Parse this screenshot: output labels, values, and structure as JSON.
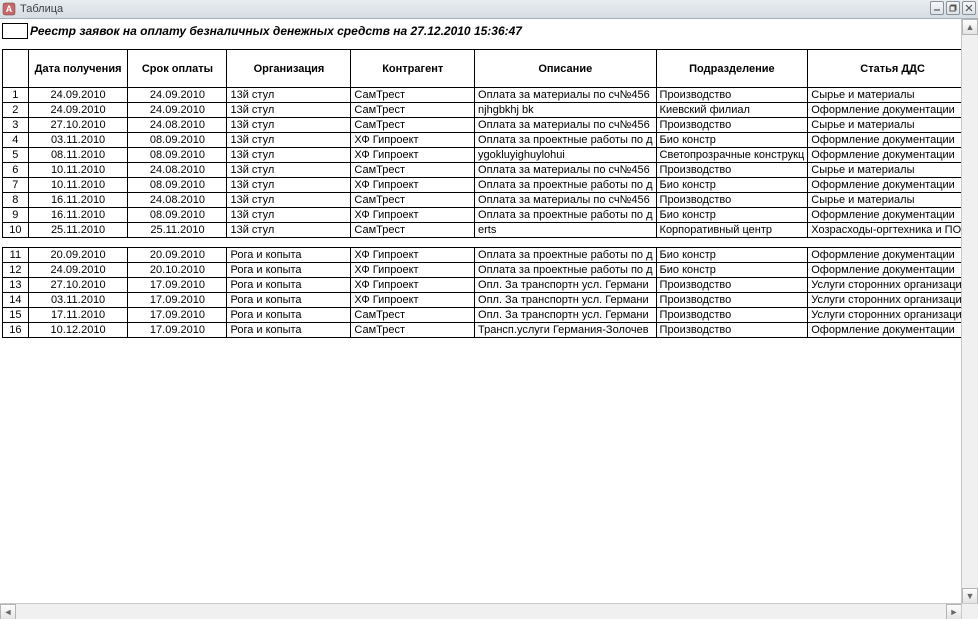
{
  "window": {
    "title": "Таблица"
  },
  "report": {
    "title": "Реестр заявок на оплату безналичных денежных средств на 27.12.2010 15:36:47"
  },
  "table": {
    "headers": {
      "num": "",
      "date_received": "Дата получения",
      "due_date": "Срок оплаты",
      "organization": "Организация",
      "counterparty": "Контрагент",
      "description": "Описание",
      "department": "Подразделение",
      "dds": "Статья ДДС"
    },
    "groups": [
      {
        "rows": [
          {
            "num": "1",
            "date_received": "24.09.2010",
            "due_date": "24.09.2010",
            "organization": "13й стул",
            "counterparty": "СамТрест",
            "description": "Оплата за материалы по сч№456",
            "department": "Производство",
            "dds": "Сырье и материалы"
          },
          {
            "num": "2",
            "date_received": "24.09.2010",
            "due_date": "24.09.2010",
            "organization": "13й стул",
            "counterparty": "СамТрест",
            "description": "njhgbkhj bk",
            "department": "Киевский филиал",
            "dds": "Оформление документации"
          },
          {
            "num": "3",
            "date_received": "27.10.2010",
            "due_date": "24.08.2010",
            "organization": "13й стул",
            "counterparty": "СамТрест",
            "description": "Оплата за материалы по сч№456",
            "department": "Производство",
            "dds": "Сырье и материалы"
          },
          {
            "num": "4",
            "date_received": "03.11.2010",
            "due_date": "08.09.2010",
            "organization": "13й стул",
            "counterparty": "ХФ Гипроект",
            "description": "Оплата за проектные работы по д",
            "department": "Био констр",
            "dds": "Оформление документации"
          },
          {
            "num": "5",
            "date_received": "08.11.2010",
            "due_date": "08.09.2010",
            "organization": "13й стул",
            "counterparty": "ХФ Гипроект",
            "description": "ygokluyighuylohui",
            "department": "Светопрозрачные конструкц",
            "dds": "Оформление документации"
          },
          {
            "num": "6",
            "date_received": "10.11.2010",
            "due_date": "24.08.2010",
            "organization": "13й стул",
            "counterparty": "СамТрест",
            "description": "Оплата за материалы по сч№456",
            "department": "Производство",
            "dds": "Сырье и материалы"
          },
          {
            "num": "7",
            "date_received": "10.11.2010",
            "due_date": "08.09.2010",
            "organization": "13й стул",
            "counterparty": "ХФ Гипроект",
            "description": "Оплата за проектные работы по д",
            "department": "Био констр",
            "dds": "Оформление документации"
          },
          {
            "num": "8",
            "date_received": "16.11.2010",
            "due_date": "24.08.2010",
            "organization": "13й стул",
            "counterparty": "СамТрест",
            "description": "Оплата за материалы по сч№456",
            "department": "Производство",
            "dds": "Сырье и материалы"
          },
          {
            "num": "9",
            "date_received": "16.11.2010",
            "due_date": "08.09.2010",
            "organization": "13й стул",
            "counterparty": "ХФ Гипроект",
            "description": "Оплата за проектные работы по д",
            "department": "Био констр",
            "dds": "Оформление документации"
          },
          {
            "num": "10",
            "date_received": "25.11.2010",
            "due_date": "25.11.2010",
            "organization": "13й стул",
            "counterparty": "СамТрест",
            "description": "erts",
            "department": "Корпоративный центр",
            "dds": "Хозрасходы-оргтехника и ПО"
          }
        ]
      },
      {
        "rows": [
          {
            "num": "11",
            "date_received": "20.09.2010",
            "due_date": "20.09.2010",
            "organization": "Рога и копыта",
            "counterparty": "ХФ Гипроект",
            "description": "Оплата за проектные работы по д",
            "department": "Био констр",
            "dds": "Оформление документации"
          },
          {
            "num": "12",
            "date_received": "24.09.2010",
            "due_date": "20.10.2010",
            "organization": "Рога и копыта",
            "counterparty": "ХФ Гипроект",
            "description": "Оплата за проектные работы по д",
            "department": "Био констр",
            "dds": "Оформление документации"
          },
          {
            "num": "13",
            "date_received": "27.10.2010",
            "due_date": "17.09.2010",
            "organization": "Рога и копыта",
            "counterparty": "ХФ Гипроект",
            "description": "Опл. За транспортн усл. Германи",
            "department": "Производство",
            "dds": "Услуги сторонних организаций"
          },
          {
            "num": "14",
            "date_received": "03.11.2010",
            "due_date": "17.09.2010",
            "organization": "Рога и копыта",
            "counterparty": "ХФ Гипроект",
            "description": "Опл. За транспортн усл. Германи",
            "department": "Производство",
            "dds": "Услуги сторонних организаций"
          },
          {
            "num": "15",
            "date_received": "17.11.2010",
            "due_date": "17.09.2010",
            "organization": "Рога и копыта",
            "counterparty": "СамТрест",
            "description": "Опл. За транспортн усл. Германи",
            "department": "Производство",
            "dds": "Услуги сторонних организаций"
          },
          {
            "num": "16",
            "date_received": "10.12.2010",
            "due_date": "17.09.2010",
            "organization": "Рога и копыта",
            "counterparty": "СамТрест",
            "description": "Трансп.услуги Германия-Золочев",
            "department": "Производство",
            "dds": "Оформление документации"
          }
        ]
      }
    ]
  }
}
